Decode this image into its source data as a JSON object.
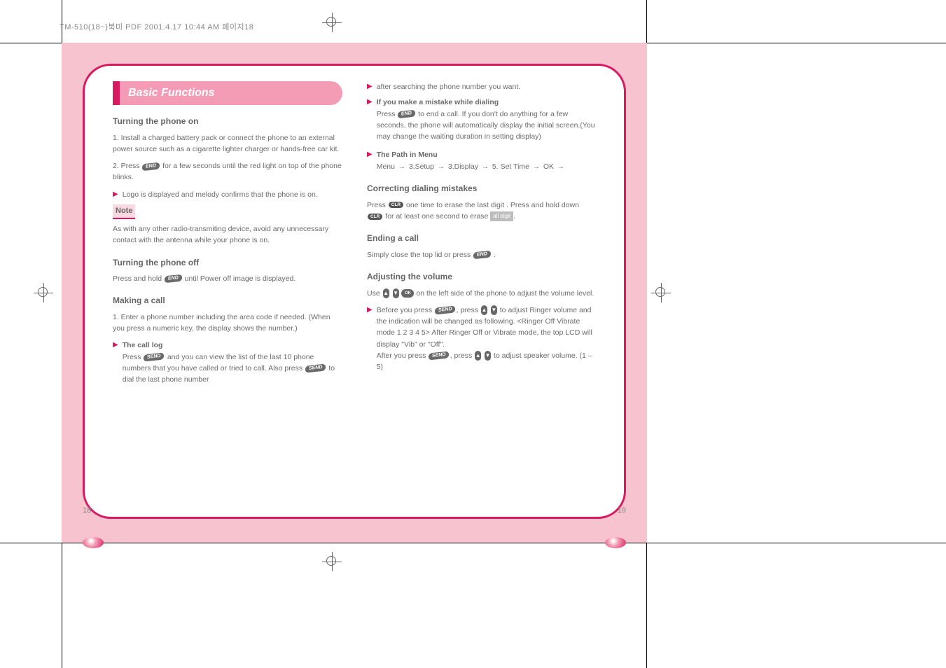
{
  "header": "TM-510(18~)북미 PDF  2001.4.17 10:44 AM  페이지18",
  "title": "Basic Functions",
  "left": {
    "h_on": "Turning the phone on",
    "p_on_1": "1. Install a charged battery pack or connect the phone to an external power source such as a cigarette lighter charger or hands-free car kit.",
    "p_on_2_a": "2. Press",
    "p_on_2_b": "for a few seconds until the red light on top of the phone blinks.",
    "p_on_3": "Logo is displayed and melody confirms that the phone is on.",
    "note_label": "Note",
    "note_body": "As with any other radio-transmiting device, avoid any unnecessary contact with the antenna while your phone is on.",
    "h_off": "Turning the phone off",
    "p_off_a": "Press and hold",
    "p_off_b": "until Power off image is displayed.",
    "h_call": "Making a call",
    "p_call_1": "1. Enter a phone number including the area code if needed. (When you press a numeric key, the display shows the number.)",
    "p_call_2": "The call log",
    "p_call_3_a": "Press",
    "p_call_3_b": "and you can view the list of the last 10 phone numbers that you have called or tried to call. Also press",
    "p_call_3_c": "to dial the last phone number"
  },
  "right": {
    "p1": "after searching the phone number you want.",
    "p2": "If you make a mistake while dialing",
    "p3_a": "Press",
    "p3_b": "to end a call.  If you don't do anything for a few seconds, the phone will automatically display the initial screen.(You may change the waiting duration in setting display)",
    "p4": "The Path in Menu",
    "p5_a": "Menu",
    "p5_b": "3.Setup",
    "p5_c": "3.Display",
    "p5_d": "5. Set Time",
    "p5_e": "OK",
    "h_erase": "Correcting dialing mistakes",
    "p_erase_1_a": "Press",
    "p_erase_1_b": "one time to erase the last digit . Press and hold down",
    "p_erase_1_c": "for at least one second to erase",
    "p_erase_1_d": "all digit",
    "h_end": "Ending a call",
    "p_end_a": "Simply close the top lid or press",
    "p_end_b": ".",
    "h_adj": "Adjusting the volume",
    "p_adj_1_a": "Use",
    "p_adj_1_b": "on the left side of the phone to adjust the volume level.",
    "p_adj_2_a": "Before you press",
    "p_adj_2_b": "press",
    "p_adj_2_c": "to adjust Ringer volume and the indication will be changed as following. <Ringer Off         Vibrate mode          1          2          3          4          5>  After Ringer Off or Vibrate mode, the top LCD will display \"Vib\" or \"Off\".",
    "p_adj_3_a": "After you press",
    "p_adj_3_b": "press",
    "p_adj_3_c": "to adjust speaker volume. (1 – 5)"
  },
  "page_left": "18",
  "page_right": "19"
}
